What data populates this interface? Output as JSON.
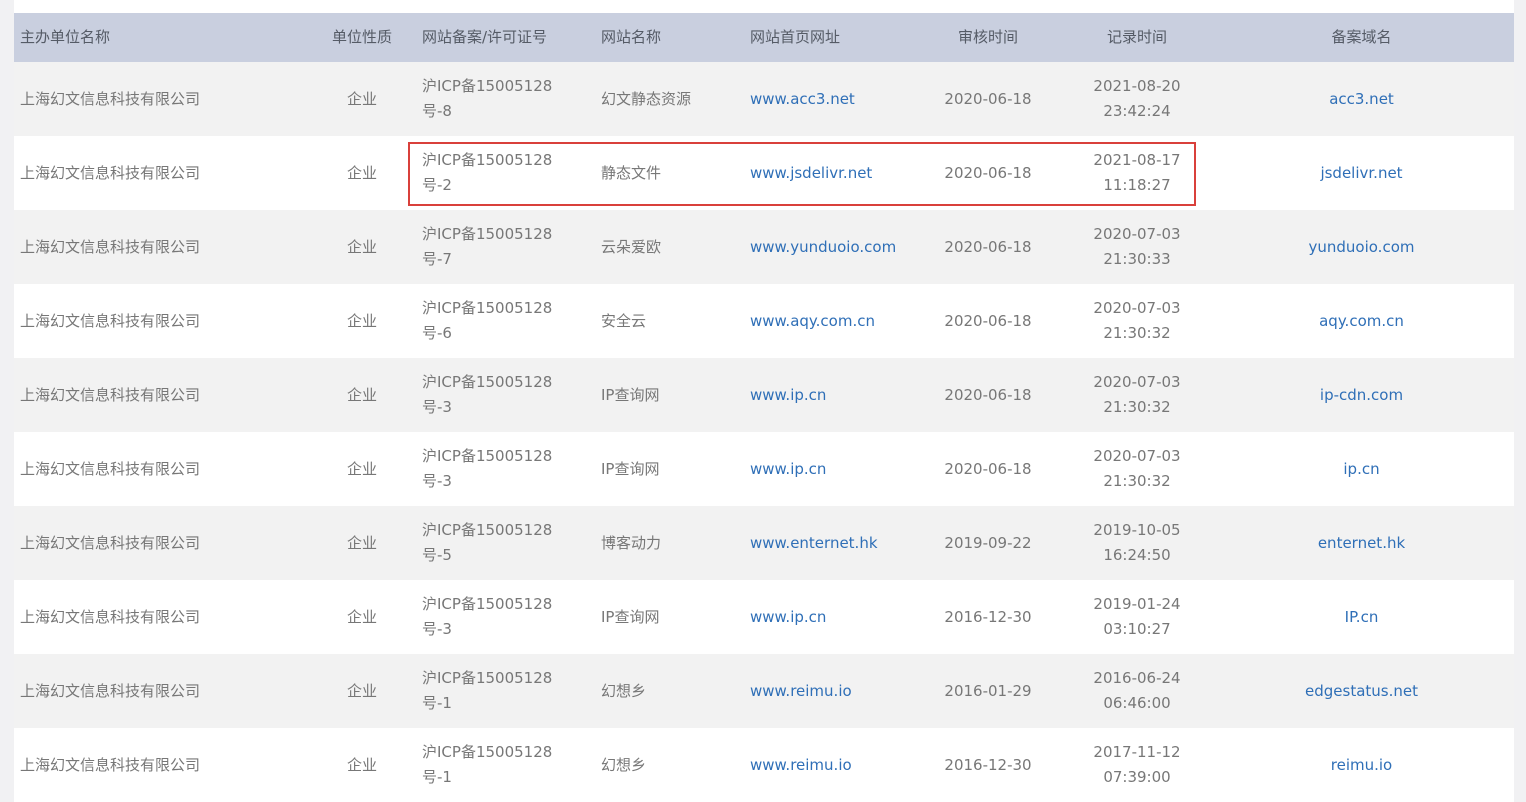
{
  "headers": [
    "主办单位名称",
    "单位性质",
    "网站备案/许可证号",
    "网站名称",
    "网站首页网址",
    "审核时间",
    "记录时间",
    "备案域名"
  ],
  "rows": [
    {
      "org": "上海幻文信息科技有限公司",
      "type": "企业",
      "icp_line1": "沪ICP备15005128",
      "icp_line2": "号-8",
      "site_name": "幻文静态资源",
      "homepage": "www.acc3.net",
      "review_date": "2020-06-18",
      "record_date": "2021-08-20",
      "record_time": "23:42:24",
      "domain": "acc3.net"
    },
    {
      "org": "上海幻文信息科技有限公司",
      "type": "企业",
      "icp_line1": "沪ICP备15005128",
      "icp_line2": "号-2",
      "site_name": "静态文件",
      "homepage": "www.jsdelivr.net",
      "review_date": "2020-06-18",
      "record_date": "2021-08-17",
      "record_time": "11:18:27",
      "domain": "jsdelivr.net"
    },
    {
      "org": "上海幻文信息科技有限公司",
      "type": "企业",
      "icp_line1": "沪ICP备15005128",
      "icp_line2": "号-7",
      "site_name": "云朵爱欧",
      "homepage": "www.yunduoio.com",
      "review_date": "2020-06-18",
      "record_date": "2020-07-03",
      "record_time": "21:30:33",
      "domain": "yunduoio.com"
    },
    {
      "org": "上海幻文信息科技有限公司",
      "type": "企业",
      "icp_line1": "沪ICP备15005128",
      "icp_line2": "号-6",
      "site_name": "安全云",
      "homepage": "www.aqy.com.cn",
      "review_date": "2020-06-18",
      "record_date": "2020-07-03",
      "record_time": "21:30:32",
      "domain": "aqy.com.cn"
    },
    {
      "org": "上海幻文信息科技有限公司",
      "type": "企业",
      "icp_line1": "沪ICP备15005128",
      "icp_line2": "号-3",
      "site_name": "IP查询网",
      "homepage": "www.ip.cn",
      "review_date": "2020-06-18",
      "record_date": "2020-07-03",
      "record_time": "21:30:32",
      "domain": "ip-cdn.com"
    },
    {
      "org": "上海幻文信息科技有限公司",
      "type": "企业",
      "icp_line1": "沪ICP备15005128",
      "icp_line2": "号-3",
      "site_name": "IP查询网",
      "homepage": "www.ip.cn",
      "review_date": "2020-06-18",
      "record_date": "2020-07-03",
      "record_time": "21:30:32",
      "domain": "ip.cn"
    },
    {
      "org": "上海幻文信息科技有限公司",
      "type": "企业",
      "icp_line1": "沪ICP备15005128",
      "icp_line2": "号-5",
      "site_name": "博客动力",
      "homepage": "www.enternet.hk",
      "review_date": "2019-09-22",
      "record_date": "2019-10-05",
      "record_time": "16:24:50",
      "domain": "enternet.hk"
    },
    {
      "org": "上海幻文信息科技有限公司",
      "type": "企业",
      "icp_line1": "沪ICP备15005128",
      "icp_line2": "号-3",
      "site_name": "IP查询网",
      "homepage": "www.ip.cn",
      "review_date": "2016-12-30",
      "record_date": "2019-01-24",
      "record_time": "03:10:27",
      "domain": "IP.cn"
    },
    {
      "org": "上海幻文信息科技有限公司",
      "type": "企业",
      "icp_line1": "沪ICP备15005128",
      "icp_line2": "号-1",
      "site_name": "幻想乡",
      "homepage": "www.reimu.io",
      "review_date": "2016-01-29",
      "record_date": "2016-06-24",
      "record_time": "06:46:00",
      "domain": "edgestatus.net"
    },
    {
      "org": "上海幻文信息科技有限公司",
      "type": "企业",
      "icp_line1": "沪ICP备15005128",
      "icp_line2": "号-1",
      "site_name": "幻想乡",
      "homepage": "www.reimu.io",
      "review_date": "2016-12-30",
      "record_date": "2017-11-12",
      "record_time": "07:39:00",
      "domain": "reimu.io"
    }
  ],
  "highlight_color": "#d9403b",
  "link_color": "#2f6fb7",
  "header_bg": "#c9cfdf"
}
